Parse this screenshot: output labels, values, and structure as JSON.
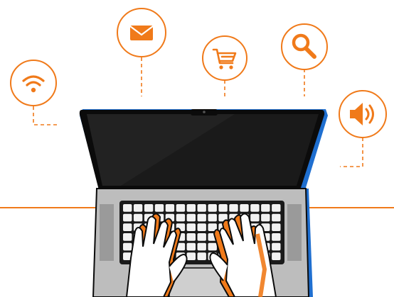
{
  "colors": {
    "accent": "#F07A1A",
    "outline": "#0B0B0B",
    "screen": "#121212",
    "laptop_body": "#BDBDBD",
    "laptop_blue": "#1F6FD0",
    "skin": "#FFFFFF"
  },
  "icons": [
    {
      "name": "wifi-icon"
    },
    {
      "name": "mail-icon"
    },
    {
      "name": "shopping-cart-icon"
    },
    {
      "name": "search-icon"
    },
    {
      "name": "speaker-icon"
    }
  ],
  "scene": {
    "device": "laptop",
    "view": "top-down",
    "hands": 2
  }
}
